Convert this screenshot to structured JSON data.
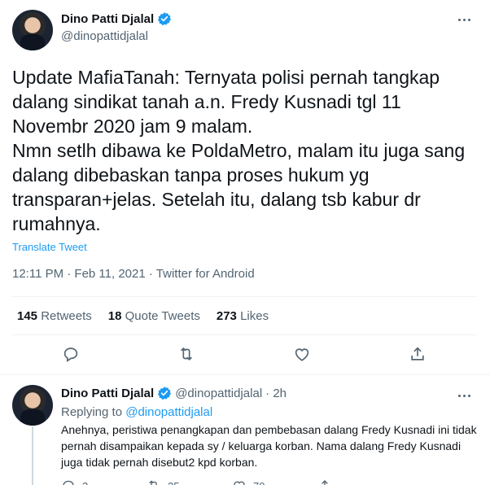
{
  "tweet": {
    "author_name": "Dino Patti Djalal",
    "author_handle": "@dinopattidjalal",
    "text": "Update MafiaTanah: Ternyata polisi pernah tangkap dalang sindikat tanah a.n. Fredy Kusnadi tgl 11 Novembr 2020 jam 9 malam.\nNmn setlh dibawa ke PoldaMetro, malam itu juga sang dalang dibebaskan tanpa proses hukum yg transparan+jelas. Setelah itu, dalang tsb kabur dr rumahnya.",
    "translate_label": "Translate Tweet",
    "timestamp": "12:11 PM · Feb 11, 2021 · Twitter for Android",
    "stats": {
      "retweets_count": "145",
      "retweets_label": "Retweets",
      "quotes_count": "18",
      "quotes_label": "Quote Tweets",
      "likes_count": "273",
      "likes_label": "Likes"
    }
  },
  "reply": {
    "author_name": "Dino Patti Djalal",
    "author_handle": "@dinopattidjalal",
    "time": "· 2h",
    "replying_prefix": "Replying to",
    "replying_to": "@dinopattidjalal",
    "text": "Anehnya, peristiwa penangkapan dan pembebasan dalang Fredy Kusnadi ini tidak pernah disampaikan kepada sy / keluarga korban. Nama dalang Fredy Kusnadi juga tidak pernah disebut2 kpd korban.",
    "reply_count": "2",
    "retweet_count": "25",
    "like_count": "70"
  },
  "colors": {
    "accent": "#1d9bf0",
    "text_primary": "#0f1419",
    "text_secondary": "#536471",
    "divider": "#eff3f4"
  },
  "icons": [
    "verified-badge-icon",
    "more-icon",
    "reply-icon",
    "retweet-icon",
    "like-icon",
    "share-icon"
  ]
}
